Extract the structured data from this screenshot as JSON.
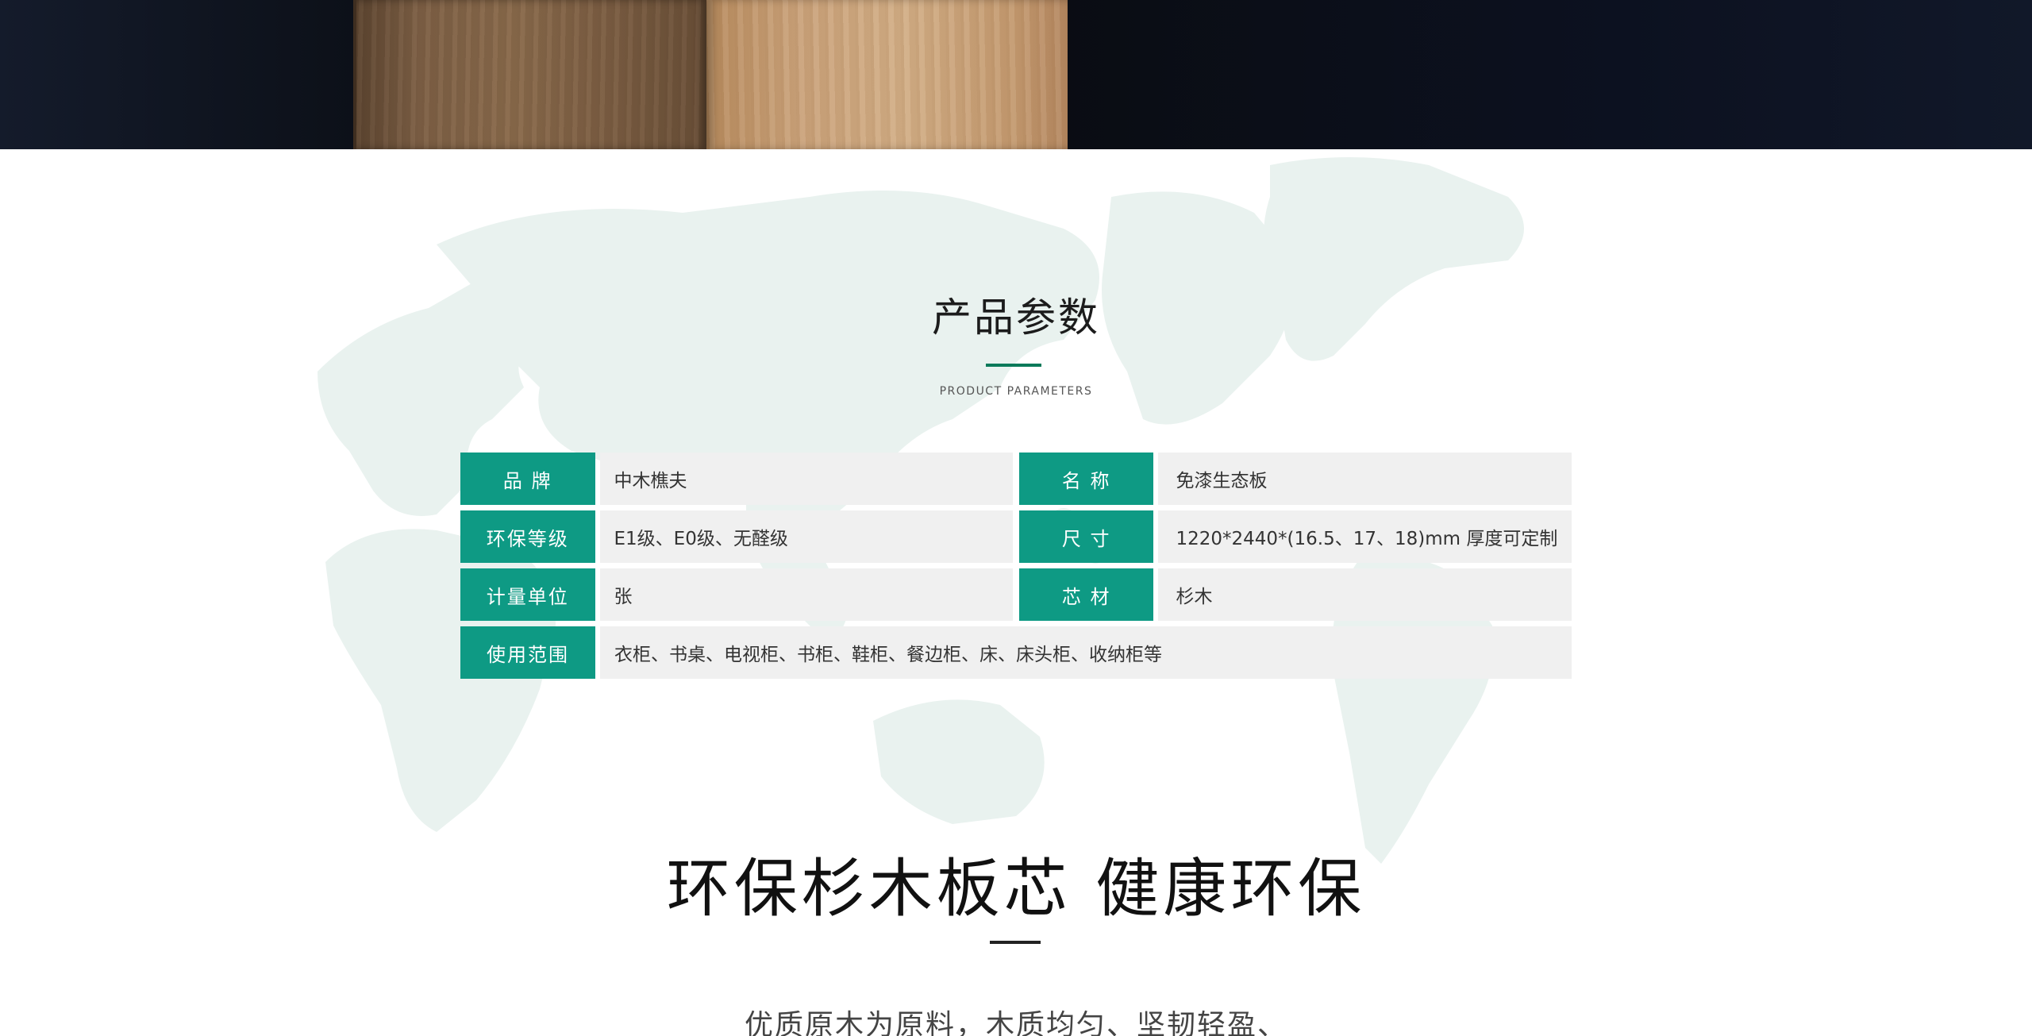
{
  "section": {
    "title": "产品参数",
    "subtitle": "PRODUCT PARAMETERS"
  },
  "params": [
    {
      "label": "品 牌",
      "value": "中木樵夫",
      "label2": "名 称",
      "value2": "免漆生态板"
    },
    {
      "label": "环保等级",
      "value": "E1级、E0级、无醛级",
      "label2": "尺 寸",
      "value2": "1220*2440*(16.5、17、18)mm 厚度可定制"
    },
    {
      "label": "计量单位",
      "value": "张",
      "label2": "芯 材",
      "value2": "杉木"
    },
    {
      "label": "使用范围",
      "value": "衣柜、书桌、电视柜、书柜、鞋柜、餐边柜、床、床头柜、收纳柜等"
    }
  ],
  "slogan": "环保杉木板芯 健康环保",
  "description": "优质原木为原料，木质均匀、坚韧轻盈、",
  "colors": {
    "accent_green": "#0e9a84",
    "title_underline": "#0b7a5a",
    "value_bg": "#f0f0f0",
    "map_fill": "#e9f2ef"
  }
}
